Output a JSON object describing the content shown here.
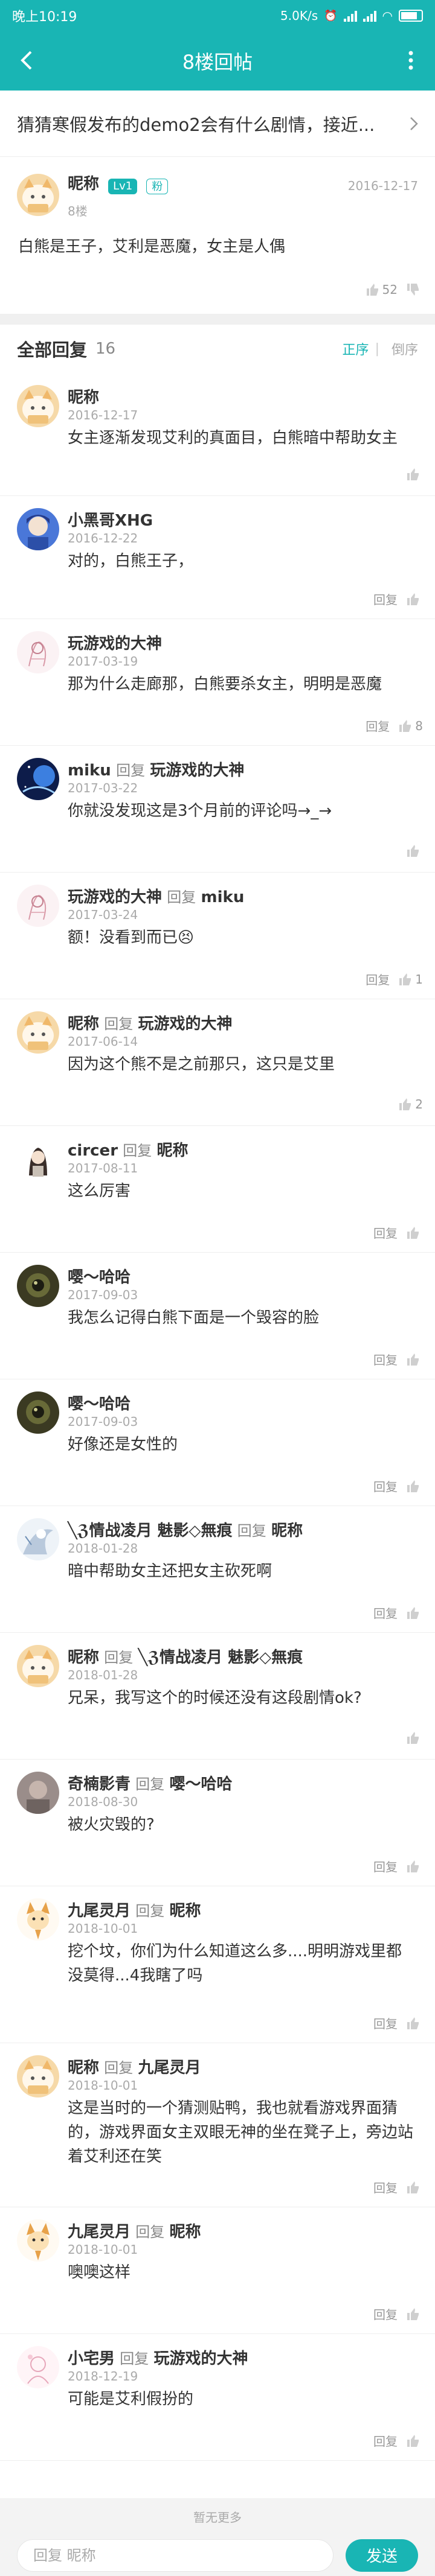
{
  "status_bar": {
    "time": "晚上10:19",
    "speed": "5.0K/s"
  },
  "nav": {
    "title": "8楼回帖"
  },
  "topic": {
    "title": "猜猜寒假发布的demo2会有什么剧情，接近..."
  },
  "floor_post": {
    "user": "昵称",
    "level": "Lv1",
    "tag": "粉",
    "date": "2016-12-17",
    "floor": "8楼",
    "content": "白熊是王子，艾利是恶魔，女主是人偶",
    "likes": "52"
  },
  "replies_header": {
    "label": "全部回复",
    "count": "16",
    "sort_asc": "正序",
    "sort_desc": "倒序"
  },
  "reply_label": "回复",
  "colors": {
    "accent": "#19b5b4"
  },
  "comments": [
    {
      "user": "昵称",
      "target": "",
      "date": "2016-12-17",
      "text": "女主逐渐发现艾利的真面目，白熊暗中帮助女主",
      "show_reply": false,
      "likes": "",
      "avatar": "cat"
    },
    {
      "user": "小黑哥XHG",
      "target": "",
      "date": "2016-12-22",
      "text": "对的，白熊王子，",
      "show_reply": true,
      "likes": "",
      "avatar": "blue"
    },
    {
      "user": "玩游戏的大神",
      "target": "",
      "date": "2017-03-19",
      "text": "那为什么走廊那，白熊要杀女主，明明是恶魔",
      "show_reply": true,
      "likes": "8",
      "avatar": "sketch"
    },
    {
      "user": "miku",
      "target": "玩游戏的大神",
      "date": "2017-03-22",
      "text": "你就没发现这是3个月前的评论吗→_→",
      "show_reply": false,
      "likes": "",
      "avatar": "space"
    },
    {
      "user": "玩游戏的大神",
      "target": "miku",
      "date": "2017-03-24",
      "text": "额！没看到而已😣",
      "show_reply": true,
      "likes": "1",
      "avatar": "sketch"
    },
    {
      "user": "昵称",
      "target": "玩游戏的大神",
      "date": "2017-06-14",
      "text": "因为这个熊不是之前那只，这只是艾里",
      "show_reply": false,
      "likes": "2",
      "avatar": "cat"
    },
    {
      "user": "circer",
      "target": "昵称",
      "date": "2017-08-11",
      "text": "这么厉害",
      "show_reply": true,
      "likes": "",
      "avatar": "girl"
    },
    {
      "user": "嘤～哈哈",
      "target": "",
      "date": "2017-09-03",
      "text": "我怎么记得白熊下面是一个毁容的脸",
      "show_reply": true,
      "likes": "",
      "avatar": "dark"
    },
    {
      "user": "嘤～哈哈",
      "target": "",
      "date": "2017-09-03",
      "text": "好像还是女性的",
      "show_reply": true,
      "likes": "",
      "avatar": "dark"
    },
    {
      "user": "╲ℨ情战凌月 魅影◇無痕",
      "target": "昵称",
      "date": "2018-01-28",
      "text": "暗中帮助女主还把女主砍死啊",
      "show_reply": true,
      "likes": "",
      "avatar": "white"
    },
    {
      "user": "昵称",
      "target": "╲ℨ情战凌月 魅影◇無痕",
      "date": "2018-01-28",
      "text": "兄呆，我写这个的时候还没有这段剧情ok?",
      "show_reply": false,
      "likes": "",
      "avatar": "cat"
    },
    {
      "user": "奇楠影青",
      "target": "嘤～哈哈",
      "date": "2018-08-30",
      "text": "被火灾毁的?",
      "show_reply": true,
      "likes": "",
      "avatar": "gray"
    },
    {
      "user": "九尾灵月",
      "target": "昵称",
      "date": "2018-10-01",
      "text": "挖个坟，你们为什么知道这么多....明明游戏里都没莫得...4我瞎了吗",
      "show_reply": true,
      "likes": "",
      "avatar": "fox"
    },
    {
      "user": "昵称",
      "target": "九尾灵月",
      "date": "2018-10-01",
      "text": "这是当时的一个猜测贴鸭，我也就看游戏界面猜的，游戏界面女主双眼无神的坐在凳子上，旁边站着艾利还在笑",
      "show_reply": true,
      "likes": "",
      "avatar": "cat"
    },
    {
      "user": "九尾灵月",
      "target": "昵称",
      "date": "2018-10-01",
      "text": "噢噢这样",
      "show_reply": true,
      "likes": "",
      "avatar": "fox"
    },
    {
      "user": "小宅男",
      "target": "玩游戏的大神",
      "date": "2018-12-19",
      "text": "可能是艾利假扮的",
      "show_reply": true,
      "likes": "",
      "avatar": "pink"
    }
  ],
  "list_end": {
    "text": "暂无更多"
  },
  "composer": {
    "placeholder": "回复 昵称",
    "send": "发送"
  }
}
